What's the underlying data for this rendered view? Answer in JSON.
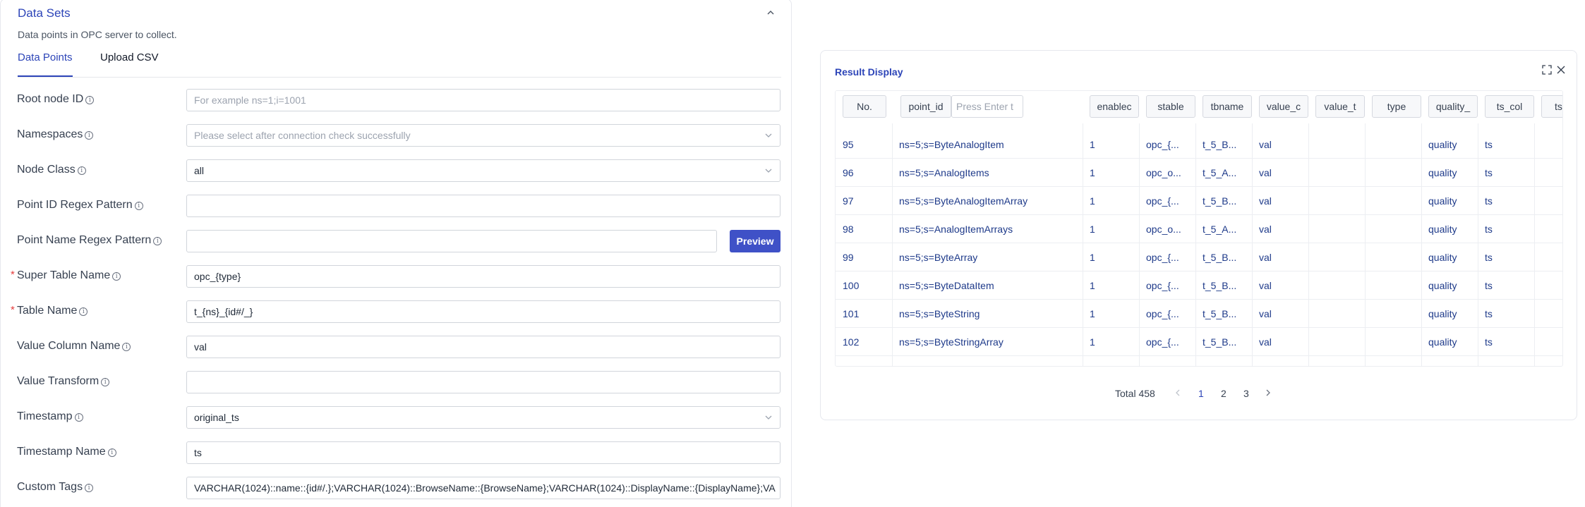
{
  "datasets": {
    "title": "Data Sets",
    "description": "Data points in OPC server to collect.",
    "tabs": [
      {
        "label": "Data Points"
      },
      {
        "label": "Upload CSV"
      }
    ],
    "fields": {
      "root_node": {
        "label": "Root node ID",
        "value": "",
        "placeholder": "For example ns=1;i=1001"
      },
      "namespaces": {
        "label": "Namespaces",
        "value": "",
        "placeholder": "Please select after connection check successfully"
      },
      "node_class": {
        "label": "Node Class",
        "value": "all"
      },
      "point_id_regex": {
        "label": "Point ID Regex Pattern",
        "value": ""
      },
      "point_name_regex": {
        "label": "Point Name Regex Pattern",
        "value": ""
      },
      "super_table": {
        "label": "Super Table Name",
        "value": "opc_{type}",
        "required_mark": "*"
      },
      "table_name": {
        "label": "Table Name",
        "value": "t_{ns}_{id#/_}",
        "required_mark": "*"
      },
      "value_column": {
        "label": "Value Column Name",
        "value": "val"
      },
      "value_transform": {
        "label": "Value Transform",
        "value": ""
      },
      "timestamp": {
        "label": "Timestamp",
        "value": "original_ts"
      },
      "timestamp_name": {
        "label": "Timestamp Name",
        "value": "ts"
      },
      "custom_tags": {
        "label": "Custom Tags",
        "value": "VARCHAR(1024)::name::{id#/.};VARCHAR(1024)::BrowseName::{BrowseName};VARCHAR(1024)::DisplayName::{DisplayName};VA"
      }
    },
    "preview_label": "Preview",
    "info_glyph": "i"
  },
  "result": {
    "title": "Result Display",
    "columns": {
      "no": "No.",
      "point_id": "point_id",
      "point_id_placeholder": "Press Enter t",
      "enabled": "enablec",
      "stable": "stable",
      "tbname": "tbname",
      "value_col": "value_c",
      "value_transform": "value_t",
      "type": "type",
      "quality": "quality_",
      "ts_col": "ts_col",
      "extra": "ts"
    },
    "rows": [
      {
        "no": "95",
        "point_id": "ns=5;s=ByteAnalogItem",
        "enabled": "1",
        "stable": "opc_{...",
        "tbname": "t_5_B...",
        "value_col": "val",
        "quality": "quality",
        "ts_col": "ts"
      },
      {
        "no": "96",
        "point_id": "ns=5;s=AnalogItems",
        "enabled": "1",
        "stable": "opc_o...",
        "tbname": "t_5_A...",
        "value_col": "val",
        "quality": "quality",
        "ts_col": "ts"
      },
      {
        "no": "97",
        "point_id": "ns=5;s=ByteAnalogItemArray",
        "enabled": "1",
        "stable": "opc_{...",
        "tbname": "t_5_B...",
        "value_col": "val",
        "quality": "quality",
        "ts_col": "ts"
      },
      {
        "no": "98",
        "point_id": "ns=5;s=AnalogItemArrays",
        "enabled": "1",
        "stable": "opc_o...",
        "tbname": "t_5_A...",
        "value_col": "val",
        "quality": "quality",
        "ts_col": "ts"
      },
      {
        "no": "99",
        "point_id": "ns=5;s=ByteArray",
        "enabled": "1",
        "stable": "opc_{...",
        "tbname": "t_5_B...",
        "value_col": "val",
        "quality": "quality",
        "ts_col": "ts"
      },
      {
        "no": "100",
        "point_id": "ns=5;s=ByteDataItem",
        "enabled": "1",
        "stable": "opc_{...",
        "tbname": "t_5_B...",
        "value_col": "val",
        "quality": "quality",
        "ts_col": "ts"
      },
      {
        "no": "101",
        "point_id": "ns=5;s=ByteString",
        "enabled": "1",
        "stable": "opc_{...",
        "tbname": "t_5_B...",
        "value_col": "val",
        "quality": "quality",
        "ts_col": "ts"
      },
      {
        "no": "102",
        "point_id": "ns=5;s=ByteStringArray",
        "enabled": "1",
        "stable": "opc_{...",
        "tbname": "t_5_B...",
        "value_col": "val",
        "quality": "quality",
        "ts_col": "ts"
      }
    ],
    "pagination": {
      "total": "Total 458",
      "pages": [
        "1",
        "2",
        "3"
      ],
      "current": "1"
    }
  },
  "colors": {
    "accent": "#2d45b8",
    "button": "#3f51c7",
    "required": "#e53e3e"
  }
}
